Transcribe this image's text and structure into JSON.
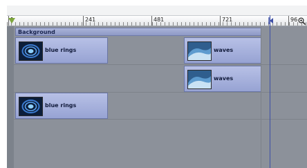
{
  "ruler": {
    "ticks": [
      "1",
      "241",
      "481",
      "721",
      "96"
    ]
  },
  "tracks": {
    "background_label": "Background",
    "clips": [
      {
        "label": "blue rings",
        "thumbnail": "blue-rings"
      },
      {
        "label": "waves",
        "thumbnail": "waves"
      },
      {
        "label": "waves",
        "thumbnail": "waves"
      },
      {
        "label": "blue rings",
        "thumbnail": "blue-rings"
      }
    ]
  },
  "colors": {
    "clip": "#9aa6d6",
    "end_line": "#3d4fa6",
    "playhead": "#7ea63d"
  }
}
